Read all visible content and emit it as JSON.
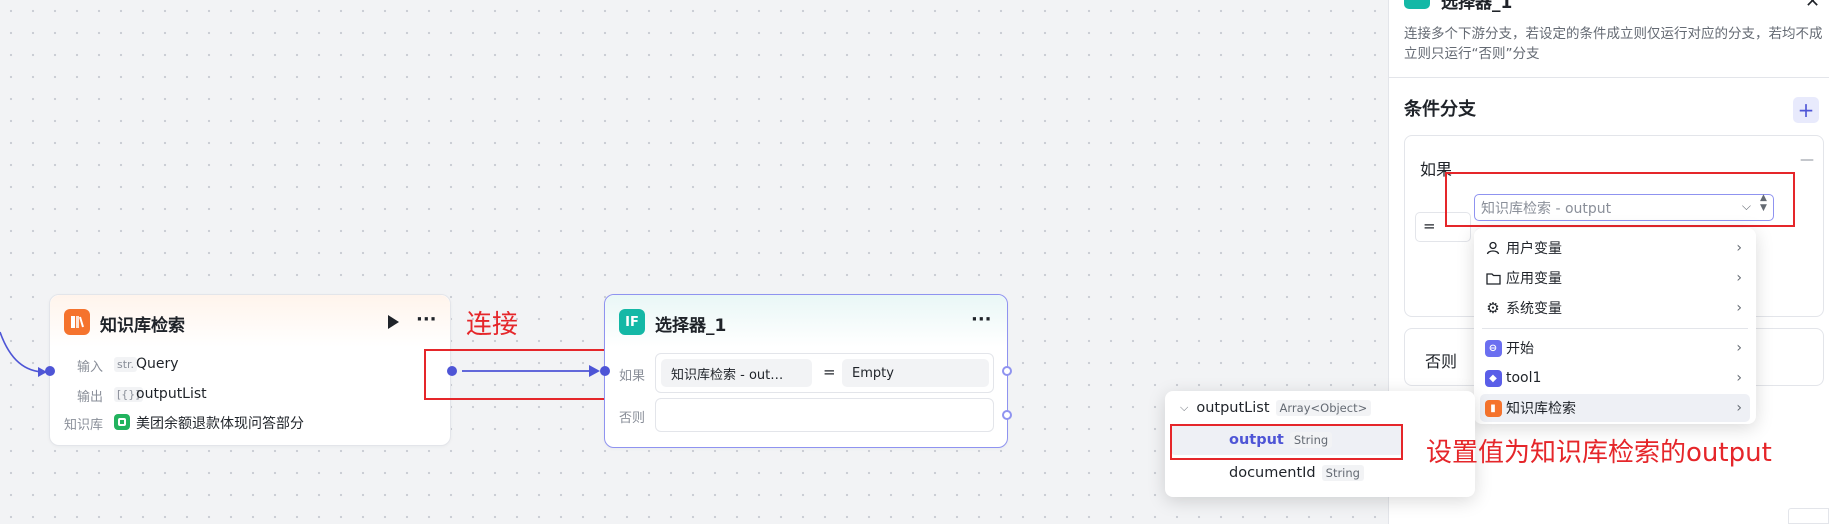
{
  "kb_node": {
    "icon": "knowledge-icon",
    "title": "知识库检索",
    "input_label": "输入",
    "input_type": "str.",
    "input_value": "Query",
    "output_label": "输出",
    "output_type": "[{}]",
    "output_value": "outputList",
    "kb_label": "知识库",
    "kb_value": "美团余额退款体现问答部分"
  },
  "connect_annotation": "连接",
  "if_node": {
    "icon_text": "IF",
    "title": "选择器_1",
    "if_label": "如果",
    "if_left": "知识库检索 - out…",
    "if_op": "=",
    "if_right": "Empty",
    "else_label": "否则"
  },
  "panel": {
    "header_title": "选择器_1",
    "description": "连接多个下游分支，若设定的条件成立则仅运行对应的分支，若均不成立则只运行“否则”分支",
    "section_title": "条件分支",
    "add_symbol": "+",
    "if_branch_label": "如果",
    "collapse_symbol": "—",
    "operator": "=",
    "select_placeholder": "知识库检索 - output",
    "else_branch_label": "否则"
  },
  "dropdown": {
    "items": [
      {
        "icon": "user-icon",
        "label": "用户变量"
      },
      {
        "icon": "folder-icon",
        "label": "应用变量"
      },
      {
        "icon": "gear-icon",
        "label": "系统变量"
      },
      {
        "icon": "start-icon",
        "label": "开始"
      },
      {
        "icon": "tool-icon",
        "label": "tool1"
      },
      {
        "icon": "knowledge-icon",
        "label": "知识库检索"
      }
    ]
  },
  "tree": {
    "parent_label": "outputList",
    "parent_type": "Array<Object>",
    "children": [
      {
        "label": "output",
        "type": "String"
      },
      {
        "label": "documentId",
        "type": "String"
      }
    ]
  },
  "set_annotation": "设置值为知识库检索的output",
  "colors": {
    "accent": "#4e55d6",
    "annotation_red": "#e5262a",
    "kb_orange": "#f5732d",
    "if_teal": "#14b8a6"
  }
}
